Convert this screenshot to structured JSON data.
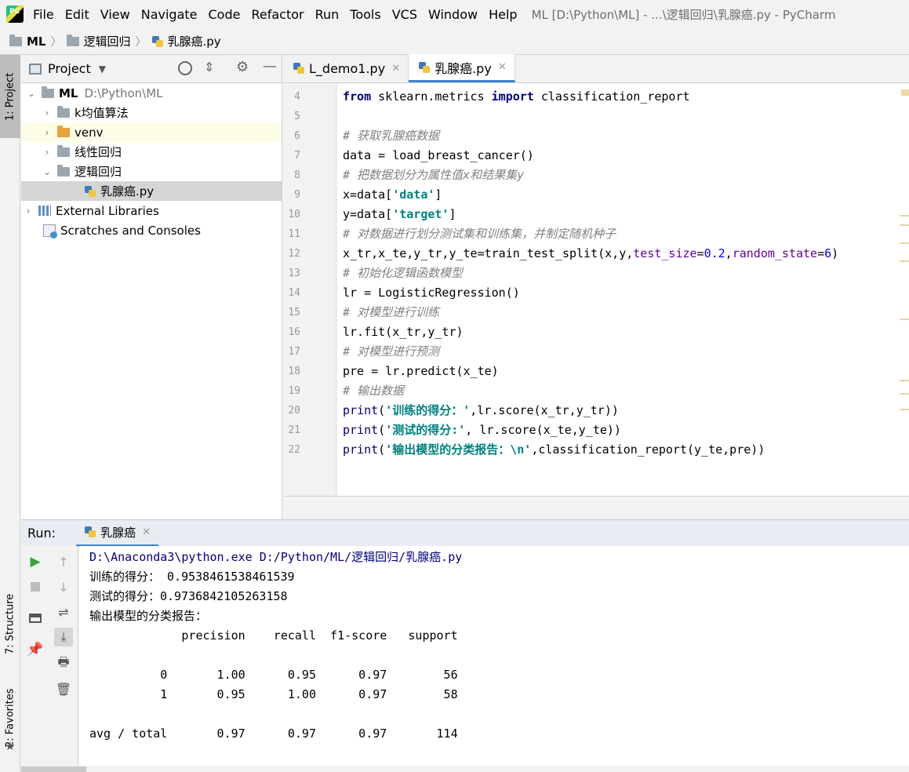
{
  "app": {
    "logo_text": "PC",
    "window_title": "ML [D:\\Python\\ML] - ...\\逻辑回归\\乳腺癌.py - PyCharm"
  },
  "menu": [
    "File",
    "Edit",
    "View",
    "Navigate",
    "Code",
    "Refactor",
    "Run",
    "Tools",
    "VCS",
    "Window",
    "Help"
  ],
  "breadcrumb": [
    "ML",
    "逻辑回归",
    "乳腺癌.py"
  ],
  "left_stripe": {
    "project_tab": "1: Project",
    "structure_tab": "7: Structure",
    "favorites_tab": "2: Favorites"
  },
  "project_panel": {
    "title": "Project",
    "tree": [
      {
        "label": "ML",
        "path": "D:\\Python\\ML"
      },
      {
        "label": "k均值算法"
      },
      {
        "label": "venv"
      },
      {
        "label": "线性回归"
      },
      {
        "label": "逻辑回归"
      },
      {
        "label": "乳腺癌.py"
      },
      {
        "label": "External Libraries"
      },
      {
        "label": "Scratches and Consoles"
      }
    ]
  },
  "editor": {
    "tabs": [
      {
        "label": "L_demo1.py"
      },
      {
        "label": "乳腺癌.py"
      }
    ],
    "line_numbers": [
      "4",
      "5",
      "6",
      "7",
      "8",
      "9",
      "10",
      "11",
      "12",
      "13",
      "14",
      "15",
      "16",
      "17",
      "18",
      "19",
      "20",
      "21",
      "22"
    ]
  },
  "run_panel": {
    "label": "Run:",
    "tab_label": "乳腺癌",
    "console": [
      "D:\\Anaconda3\\python.exe D:/Python/ML/逻辑回归/乳腺癌.py",
      "训练的得分： 0.9538461538461539",
      "测试的得分：0.9736842105263158",
      "输出模型的分类报告：",
      "             precision    recall  f1-score   support",
      "",
      "          0       1.00      0.95      0.97        56",
      "          1       0.95      1.00      0.97        58",
      "",
      "avg / total       0.97      0.97      0.97       114"
    ]
  },
  "colors": {
    "keyword": "#000080",
    "comment": "#808080",
    "string": "#008080",
    "kwarg": "#660099",
    "number": "#0000ff",
    "console_path": "#000080",
    "tab_underline": "#4083c9"
  }
}
